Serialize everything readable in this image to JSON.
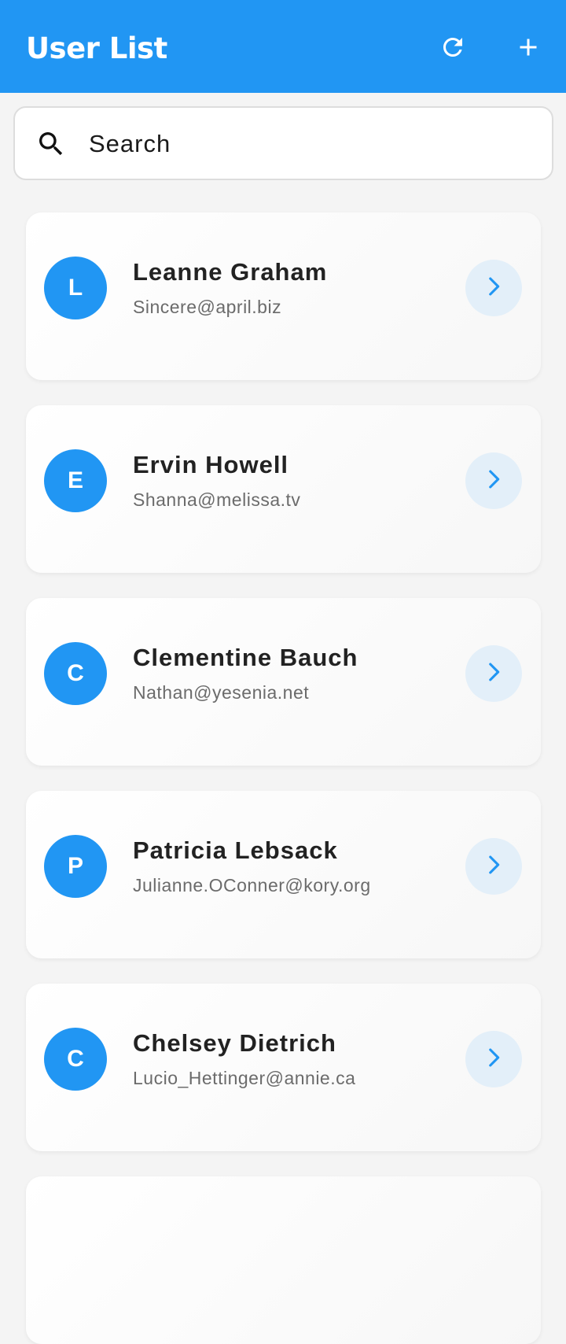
{
  "app_bar": {
    "title": "User List",
    "background": "#2196f3",
    "actions": [
      {
        "name": "refresh-icon"
      },
      {
        "name": "add-icon"
      }
    ]
  },
  "search": {
    "placeholder": "Search",
    "value": ""
  },
  "users": [
    {
      "initial": "L",
      "name": "Leanne Graham",
      "email": "Sincere@april.biz"
    },
    {
      "initial": "E",
      "name": "Ervin Howell",
      "email": "Shanna@melissa.tv"
    },
    {
      "initial": "C",
      "name": "Clementine Bauch",
      "email": "Nathan@yesenia.net"
    },
    {
      "initial": "P",
      "name": "Patricia Lebsack",
      "email": "Julianne.OConner@kory.org"
    },
    {
      "initial": "C",
      "name": "Chelsey Dietrich",
      "email": "Lucio_Hettinger@annie.ca"
    }
  ],
  "colors": {
    "accent": "#2196f3",
    "chevron_bg": "#e3eff9"
  }
}
